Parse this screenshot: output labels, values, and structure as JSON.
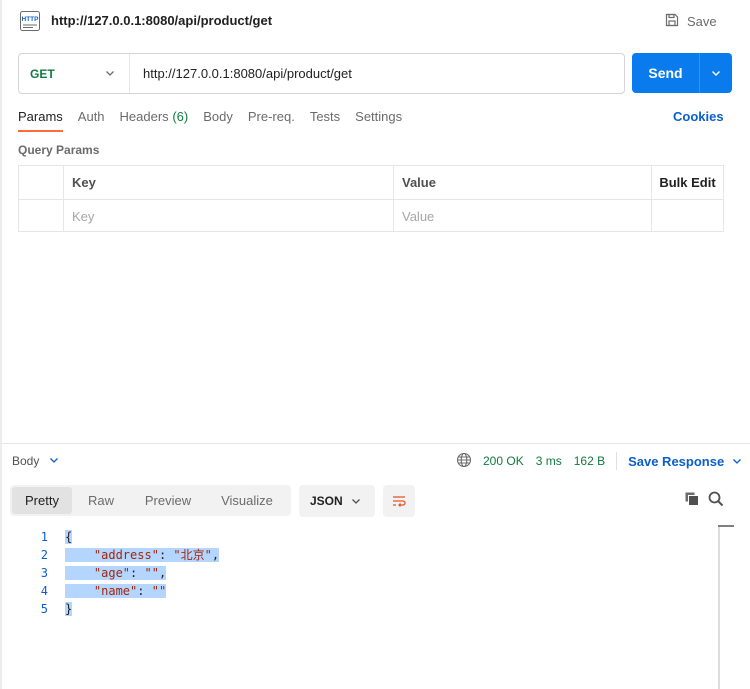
{
  "request": {
    "title": "http://127.0.0.1:8080/api/product/get",
    "save_label": "Save",
    "method": "GET",
    "url": "http://127.0.0.1:8080/api/product/get",
    "send_label": "Send"
  },
  "tabs": {
    "params": "Params",
    "auth": "Auth",
    "headers": "Headers",
    "headers_count": "(6)",
    "body": "Body",
    "prereq": "Pre-req.",
    "tests": "Tests",
    "settings": "Settings",
    "cookies": "Cookies"
  },
  "query_params": {
    "title": "Query Params",
    "col_key": "Key",
    "col_value": "Value",
    "bulk_edit": "Bulk Edit",
    "key_placeholder": "Key",
    "value_placeholder": "Value"
  },
  "response": {
    "body_label": "Body",
    "status": "200 OK",
    "time": "3 ms",
    "size": "162 B",
    "save_response": "Save Response",
    "views": [
      "Pretty",
      "Raw",
      "Preview",
      "Visualize"
    ],
    "format": "JSON",
    "code_lines": {
      "l1": "{",
      "address_key": "\"address\"",
      "address_val": "\"北京\"",
      "age_key": "\"age\"",
      "age_val": "\"\"",
      "name_key": "\"name\"",
      "name_val": "\"\"",
      "l5": "}"
    },
    "line_numbers": [
      "1",
      "2",
      "3",
      "4",
      "5"
    ]
  },
  "colors": {
    "accent": "#097bed",
    "method_get": "#0f7b3e",
    "active_tab": "#ff6c37",
    "link": "#0b5fcb",
    "json_string": "#a1260d",
    "selection": "#b4d5fe"
  }
}
